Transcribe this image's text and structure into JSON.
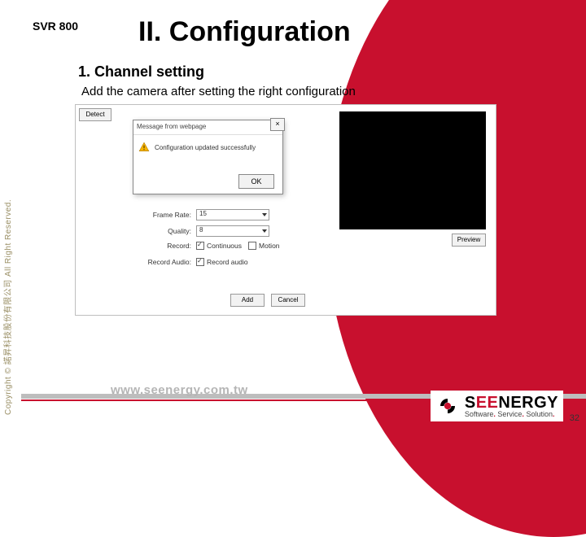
{
  "product_code": "SVR 800",
  "title": "II.    Configuration",
  "subsection": "1.  Channel setting",
  "subtext": "Add the camera after setting the right configuration",
  "screenshot": {
    "detect": "Detect",
    "form": {
      "frame_rate_label": "Frame Rate:",
      "frame_rate_value": "15",
      "quality_label": "Quality:",
      "quality_value": "8",
      "record_label": "Record:",
      "record_continuous": "Continuous",
      "record_motion": "Motion",
      "record_audio_label": "Record Audio:",
      "record_audio_opt": "Record audio"
    },
    "preview_btn": "Preview",
    "add_btn": "Add",
    "cancel_btn": "Cancel",
    "dialog": {
      "title": "Message from webpage",
      "message": "Configuration updated successfully",
      "ok": "OK",
      "close": "×"
    }
  },
  "copyright": "Copyright © 諾昇科技股份有限公司  All Right Reserved.",
  "footer_url": "www.seenergy.com.tw",
  "logo": {
    "name_a": "S",
    "name_b": "EE",
    "name_c": "NERGY",
    "tagline_parts": [
      "Software",
      "Service",
      "Solution"
    ]
  },
  "page_number": "32"
}
